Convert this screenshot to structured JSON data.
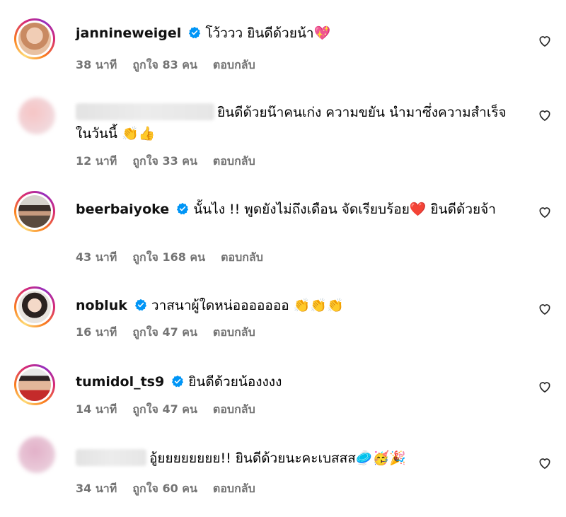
{
  "comments": [
    {
      "username": "jannineweigel",
      "verified": true,
      "text": "โว้ววว ยินดีด้วยน้า💖",
      "time": "38 นาที",
      "likes": "ถูกใจ 83 คน",
      "reply": "ตอบกลับ"
    },
    {
      "username": "",
      "verified": false,
      "text": "ยินดีด้วยน๊าคนเก่ง ความขยัน นำมาซึ่งความสำเร็จในวันนี้ 👏👍",
      "time": "12 นาที",
      "likes": "ถูกใจ 33 คน",
      "reply": "ตอบกลับ"
    },
    {
      "username": "beerbaiyoke",
      "verified": true,
      "text": "นั้นไง !! พูดยังไม่ถึงเดือน จัดเรียบร้อย❤️ ยินดีด้วยจ้า",
      "time": "43 นาที",
      "likes": "ถูกใจ 168 คน",
      "reply": "ตอบกลับ"
    },
    {
      "username": "nobluk",
      "verified": true,
      "text": "วาสนาผู้ใดหน่อออออออ 👏👏👏",
      "time": "16 นาที",
      "likes": "ถูกใจ 47 คน",
      "reply": "ตอบกลับ"
    },
    {
      "username": "tumidol_ts9",
      "verified": true,
      "text": "ยินดีด้วยน้องงงง",
      "time": "14 นาที",
      "likes": "ถูกใจ 47 คน",
      "reply": "ตอบกลับ"
    },
    {
      "username": "",
      "verified": false,
      "text": "อู้ยยยยยยยย!! ยินดีด้วยนะคะเบสสส🥏🥳🎉",
      "time": "34 นาที",
      "likes": "ถูกใจ 60 คน",
      "reply": "ตอบกลับ"
    }
  ],
  "icons": {
    "verified": "verified-badge-icon",
    "like": "heart-outline-icon"
  },
  "colors": {
    "verified": "#0095f6",
    "meta": "#737373",
    "ring_start": "#feda75",
    "ring_end": "#962fbf"
  }
}
